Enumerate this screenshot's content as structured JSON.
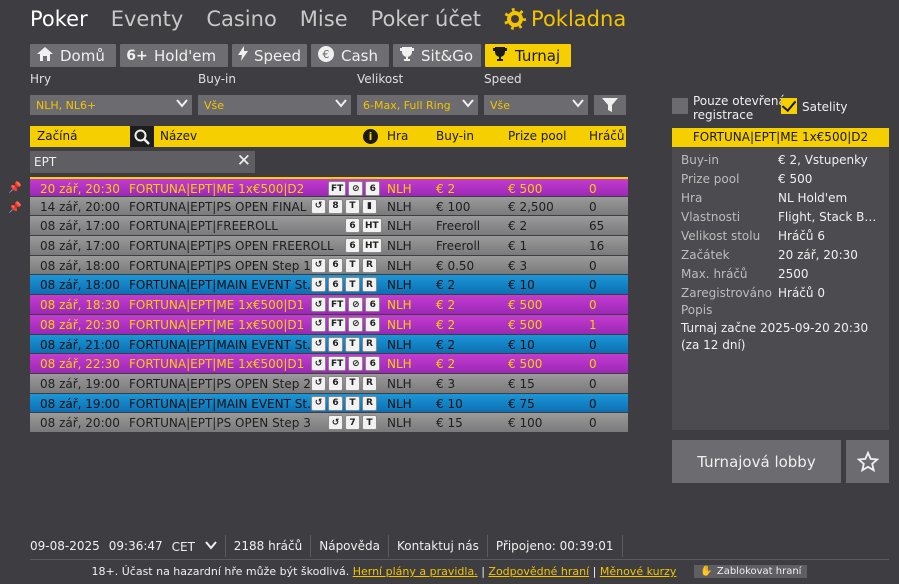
{
  "nav": {
    "poker": "Poker",
    "eventy": "Eventy",
    "casino": "Casino",
    "mise": "Mise",
    "ucet": "Poker účet",
    "pokladna": "Pokladna"
  },
  "tabs": [
    {
      "label": "Domů",
      "icon": "home-icon"
    },
    {
      "label": "Hold'em",
      "icon": "6plus-icon",
      "prefix": "6+"
    },
    {
      "label": "Speed",
      "icon": "lightning-icon"
    },
    {
      "label": "Cash",
      "icon": "euro-icon"
    },
    {
      "label": "Sit&Go",
      "icon": "trophy-icon"
    },
    {
      "label": "Turnaj",
      "icon": "cup-icon"
    }
  ],
  "filters": {
    "hry_label": "Hry",
    "hry_value": "NLH, NL6+",
    "buyin_label": "Buy-in",
    "buyin_value": "Vše",
    "velikost_label": "Velikost",
    "velikost_value": "6-Max, Full Ring",
    "speed_label": "Speed",
    "speed_value": "Vše"
  },
  "table": {
    "headers": {
      "zacina": "Začíná",
      "nazev": "Název",
      "hra": "Hra",
      "buyin": "Buy-in",
      "prize": "Prize pool",
      "hracu": "Hráčů"
    },
    "search_value": "EPT",
    "rows": [
      {
        "time": "20 zář, 20:30",
        "name": "FORTUNA|EPT|ME 1x€500|D2",
        "game": "NLH",
        "buyin": "€ 2",
        "prize": "€ 500",
        "players": "0",
        "style": "pink",
        "badges": [
          "FT",
          "⊘",
          "6"
        ],
        "pinned": true,
        "selected": true
      },
      {
        "time": "14 zář, 20:00",
        "name": "FORTUNA|EPT|PS OPEN FINAL",
        "game": "NLH",
        "buyin": "€ 100",
        "prize": "€ 2,500",
        "players": "0",
        "style": "gray",
        "badges": [
          "↺",
          "8",
          "T",
          "▮"
        ],
        "pinned": true
      },
      {
        "time": "08 zář, 17:00",
        "name": "FORTUNA|EPT|FREEROLL",
        "game": "NLH",
        "buyin": "Freeroll",
        "prize": "€ 2",
        "players": "65",
        "style": "gray",
        "badges": [
          "6",
          "HT"
        ]
      },
      {
        "time": "08 zář, 17:00",
        "name": "FORTUNA|EPT|PS OPEN FREEROLL",
        "game": "NLH",
        "buyin": "Freeroll",
        "prize": "€ 1",
        "players": "16",
        "style": "gray",
        "badges": [
          "6",
          "HT"
        ]
      },
      {
        "time": "08 zář, 18:00",
        "name": "FORTUNA|EPT|PS OPEN Step 1",
        "game": "NLH",
        "buyin": "€ 0.50",
        "prize": "€ 3",
        "players": "0",
        "style": "gray",
        "badges": [
          "↺",
          "6",
          "T",
          "R"
        ]
      },
      {
        "time": "08 zář, 18:00",
        "name": "FORTUNA|EPT|MAIN EVENT St...",
        "game": "NLH",
        "buyin": "€ 2",
        "prize": "€ 10",
        "players": "0",
        "style": "blue",
        "badges": [
          "↺",
          "6",
          "T",
          "R"
        ]
      },
      {
        "time": "08 zář, 18:30",
        "name": "FORTUNA|EPT|ME 1x€500|D1",
        "game": "NLH",
        "buyin": "€ 2",
        "prize": "€ 500",
        "players": "0",
        "style": "pink",
        "badges": [
          "↺",
          "FT",
          "⊘",
          "6"
        ]
      },
      {
        "time": "08 zář, 20:30",
        "name": "FORTUNA|EPT|ME 1x€500|D1",
        "game": "NLH",
        "buyin": "€ 2",
        "prize": "€ 500",
        "players": "1",
        "style": "pink",
        "badges": [
          "↺",
          "FT",
          "⊘",
          "6"
        ]
      },
      {
        "time": "08 zář, 21:00",
        "name": "FORTUNA|EPT|MAIN EVENT St...",
        "game": "NLH",
        "buyin": "€ 2",
        "prize": "€ 10",
        "players": "0",
        "style": "blue",
        "badges": [
          "↺",
          "6",
          "T",
          "R"
        ]
      },
      {
        "time": "08 zář, 22:30",
        "name": "FORTUNA|EPT|ME 1x€500|D1",
        "game": "NLH",
        "buyin": "€ 2",
        "prize": "€ 500",
        "players": "0",
        "style": "pink",
        "badges": [
          "↺",
          "FT",
          "⊘",
          "6"
        ]
      },
      {
        "time": "08 zář, 19:00",
        "name": "FORTUNA|EPT|PS OPEN Step 2",
        "game": "NLH",
        "buyin": "€ 3",
        "prize": "€ 15",
        "players": "0",
        "style": "gray",
        "badges": [
          "↺",
          "6",
          "T",
          "R"
        ]
      },
      {
        "time": "08 zář, 19:00",
        "name": "FORTUNA|EPT|MAIN EVENT St...",
        "game": "NLH",
        "buyin": "€ 10",
        "prize": "€ 75",
        "players": "0",
        "style": "blue",
        "badges": [
          "↺",
          "6",
          "T",
          "R"
        ]
      },
      {
        "time": "08 zář, 20:00",
        "name": "FORTUNA|EPT|PS OPEN Step 3",
        "game": "NLH",
        "buyin": "€ 15",
        "prize": "€ 100",
        "players": "0",
        "style": "gray",
        "badges": [
          "↺",
          "7",
          "T"
        ]
      }
    ]
  },
  "right": {
    "open_label": "Pouze otevřená registrace",
    "open_line1": "Pouze otevřená",
    "open_line2": "registrace",
    "satelity_label": "Satelity",
    "title": "FORTUNA|EPT|ME 1x€500|D2",
    "details": [
      {
        "k": "Buy-in",
        "v": "€ 2, Vstupenky"
      },
      {
        "k": "Prize pool",
        "v": "€ 500"
      },
      {
        "k": "Hra",
        "v": "NL Hold'em"
      },
      {
        "k": "Vlastnosti",
        "v": "Flight, Stack Build..."
      },
      {
        "k": "Velikost stolu",
        "v": "Hráčů 6"
      },
      {
        "k": "Začátek",
        "v": "20 zář, 20:30"
      },
      {
        "k": "Max. hráčů",
        "v": "2500"
      },
      {
        "k": "Zaregistrováno",
        "v": "Hráčů 0"
      }
    ],
    "popis_label": "Popis",
    "popis_text": "Turnaj začne 2025-09-20 20:30 (za 12 dní)",
    "lobby_button": "Turnajová lobby"
  },
  "status": {
    "date": "09-08-2025",
    "time": "09:36:47",
    "tz": "CET",
    "players": "2188 hráčů",
    "help": "Nápověda",
    "contact": "Kontaktuj nás",
    "connected": "Připojeno: 00:39:01"
  },
  "legal": {
    "text": "18+. Účast na hazardní hře může být škodlivá.",
    "link1": "Herní plány a pravidla.",
    "sep": "|",
    "link2": "Zodpovědné hraní",
    "link3": "Měnové kurzy",
    "block": "Zablokovat hraní"
  },
  "colors": {
    "accent": "#f5cf00",
    "background": "#3d3d42",
    "pink_row": "#b033c4",
    "blue_row": "#1584c8",
    "gray_row": "#8a8a8c"
  }
}
